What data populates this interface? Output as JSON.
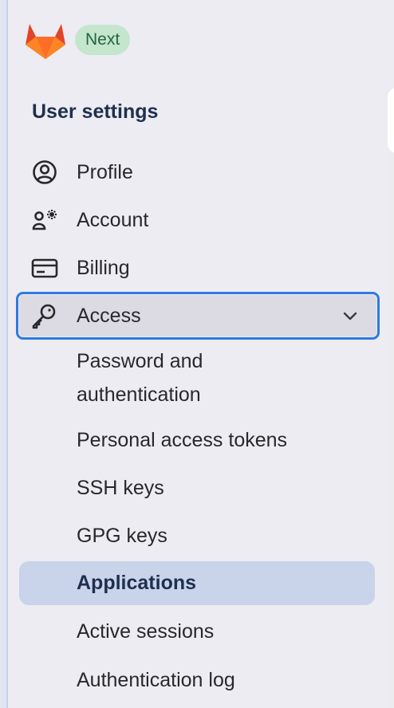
{
  "header": {
    "badge_label": "Next"
  },
  "sidebar": {
    "section_title": "User settings",
    "items": [
      {
        "label": "Profile",
        "icon": "profile-icon"
      },
      {
        "label": "Account",
        "icon": "account-icon"
      },
      {
        "label": "Billing",
        "icon": "billing-icon"
      },
      {
        "label": "Access",
        "icon": "key-icon",
        "expanded": true
      }
    ],
    "access_subitems": [
      {
        "label": "Password and\nauthentication"
      },
      {
        "label": "Personal access tokens"
      },
      {
        "label": "SSH keys"
      },
      {
        "label": "GPG keys"
      },
      {
        "label": "Applications",
        "active": true
      },
      {
        "label": "Active sessions"
      },
      {
        "label": "Authentication log"
      }
    ]
  },
  "colors": {
    "brand_orange": "#fc6d26",
    "badge_bg": "#c3e6cd",
    "badge_text": "#24663b",
    "focus_ring": "#2f7ae0",
    "active_bg": "#c9d3ea",
    "title_text": "#1f2f4f"
  }
}
